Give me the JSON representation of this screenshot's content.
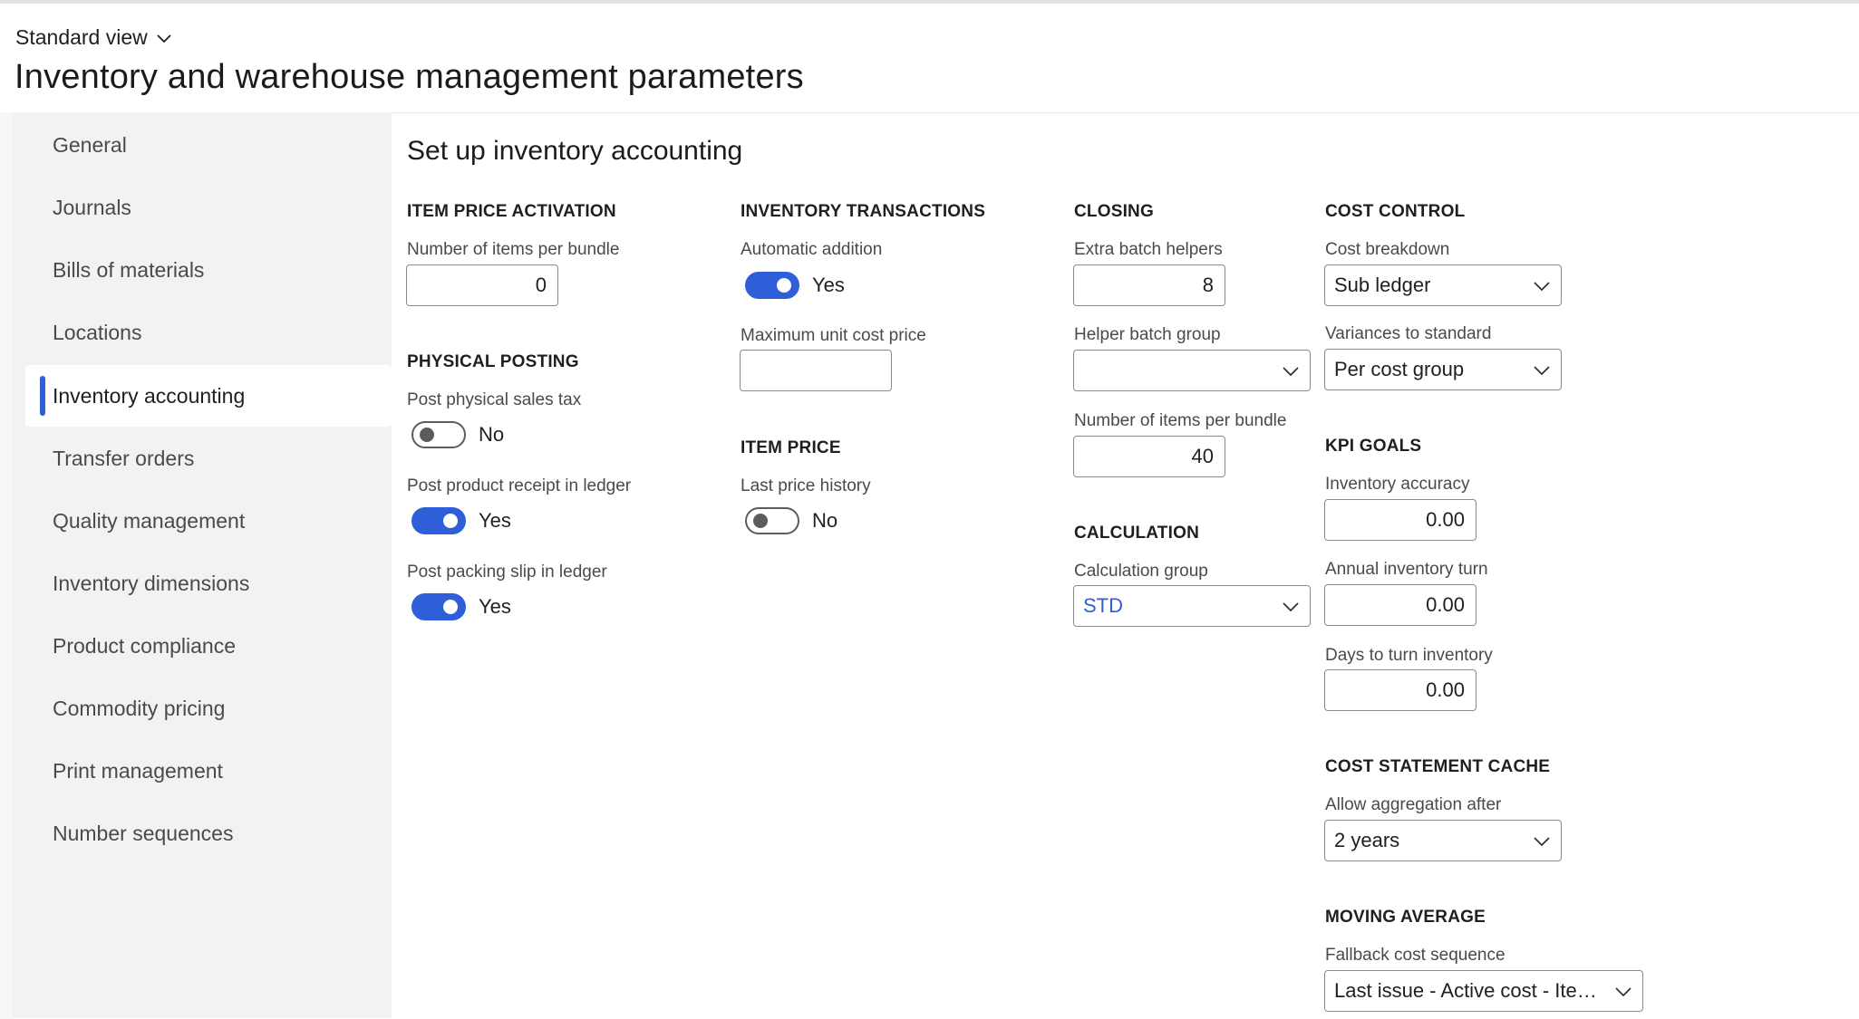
{
  "header": {
    "view_label": "Standard view",
    "title": "Inventory and warehouse management parameters"
  },
  "sidebar": {
    "items": [
      {
        "label": "General"
      },
      {
        "label": "Journals"
      },
      {
        "label": "Bills of materials"
      },
      {
        "label": "Locations"
      },
      {
        "label": "Inventory accounting"
      },
      {
        "label": "Transfer orders"
      },
      {
        "label": "Quality management"
      },
      {
        "label": "Inventory dimensions"
      },
      {
        "label": "Product compliance"
      },
      {
        "label": "Commodity pricing"
      },
      {
        "label": "Print management"
      },
      {
        "label": "Number sequences"
      }
    ],
    "active_item": "Inventory accounting"
  },
  "main": {
    "title": "Set up inventory accounting",
    "item_price_activation": {
      "heading": "ITEM PRICE ACTIVATION",
      "items_per_bundle": {
        "label": "Number of items per bundle",
        "value": "0"
      }
    },
    "physical_posting": {
      "heading": "PHYSICAL POSTING",
      "post_sales_tax": {
        "label": "Post physical sales tax",
        "state": "No"
      },
      "post_product_receipt": {
        "label": "Post product receipt in ledger",
        "state": "Yes"
      },
      "post_packing_slip": {
        "label": "Post packing slip in ledger",
        "state": "Yes"
      }
    },
    "inventory_transactions": {
      "heading": "INVENTORY TRANSACTIONS",
      "automatic_addition": {
        "label": "Automatic addition",
        "state": "Yes"
      },
      "max_unit_cost_price": {
        "label": "Maximum unit cost price",
        "value": ""
      }
    },
    "item_price": {
      "heading": "ITEM PRICE",
      "last_price_history": {
        "label": "Last price history",
        "state": "No"
      }
    },
    "closing": {
      "heading": "CLOSING",
      "extra_batch_helpers": {
        "label": "Extra batch helpers",
        "value": "8"
      },
      "helper_batch_group": {
        "label": "Helper batch group",
        "value": ""
      },
      "items_per_bundle": {
        "label": "Number of items per bundle",
        "value": "40"
      }
    },
    "calculation": {
      "heading": "CALCULATION",
      "calculation_group": {
        "label": "Calculation group",
        "value": "STD"
      }
    },
    "cost_control": {
      "heading": "COST CONTROL",
      "cost_breakdown": {
        "label": "Cost breakdown",
        "value": "Sub ledger"
      },
      "variances_to_standard": {
        "label": "Variances to standard",
        "value": "Per cost group"
      }
    },
    "kpi_goals": {
      "heading": "KPI GOALS",
      "inventory_accuracy": {
        "label": "Inventory accuracy",
        "value": "0.00"
      },
      "annual_inventory_turn": {
        "label": "Annual inventory turn",
        "value": "0.00"
      },
      "days_to_turn_inventory": {
        "label": "Days to turn inventory",
        "value": "0.00"
      }
    },
    "cost_statement_cache": {
      "heading": "COST STATEMENT CACHE",
      "allow_aggregation_after": {
        "label": "Allow aggregation after",
        "value": "2 years"
      }
    },
    "moving_average": {
      "heading": "MOVING AVERAGE",
      "fallback_cost_sequence": {
        "label": "Fallback cost sequence",
        "value": "Last issue - Active cost - Item..."
      }
    }
  },
  "colors": {
    "accent": "#2f5fd8",
    "sidebar_bg": "#f3f2f1",
    "page_bg": "#ffffff"
  },
  "icons": {
    "view_switch": "chevron-down-icon",
    "select": "chevron-down-icon"
  }
}
